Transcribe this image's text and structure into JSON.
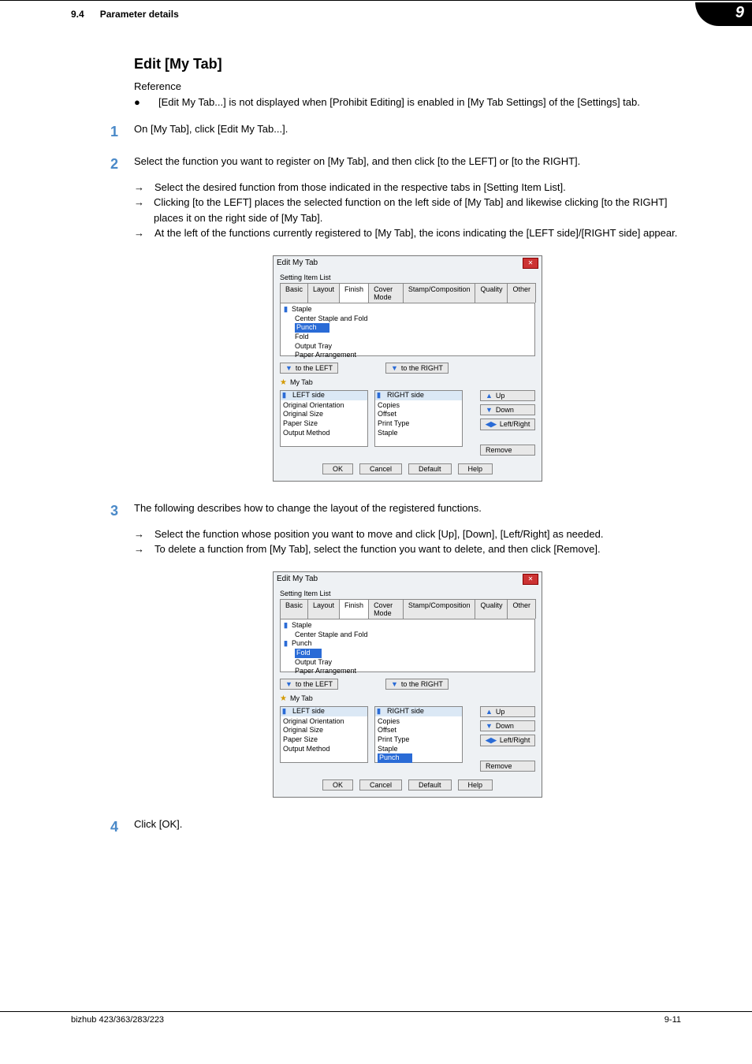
{
  "header": {
    "num": "9.4",
    "title": "Parameter details",
    "badge": "9"
  },
  "heading": "Edit [My Tab]",
  "ref_label": "Reference",
  "bullet1": "[Edit My Tab...] is not displayed when [Prohibit Editing] is enabled in [My Tab Settings] of the [Settings] tab.",
  "step1": "On [My Tab], click [Edit My Tab...].",
  "step2": "Select the function you want to register on [My Tab], and then click [to the LEFT] or [to the RIGHT].",
  "step2a": "Select the desired function from those indicated in the respective tabs in [Setting Item List].",
  "step2b": "Clicking [to the LEFT] places the selected function on the left side of [My Tab] and likewise clicking [to the RIGHT] places it on the right side of [My Tab].",
  "step2c": "At the left of the functions currently registered to [My Tab], the icons indicating the [LEFT side]/[RIGHT side] appear.",
  "step3": "The following describes how to change the layout of the registered functions.",
  "step3a": "Select the function whose position you want to move and click [Up], [Down], [Left/Right] as needed.",
  "step3b": "To delete a function from [My Tab], select the function you want to delete, and then click [Remove].",
  "step4": "Click [OK].",
  "dialog": {
    "title": "Edit My Tab",
    "sil": "Setting Item List",
    "tabs": [
      "Basic",
      "Layout",
      "Finish",
      "Cover Mode",
      "Stamp/Composition",
      "Quality",
      "Other"
    ],
    "to_left": "to the LEFT",
    "to_right": "to the RIGHT",
    "mytab": "My Tab",
    "left_hdr": "LEFT side",
    "right_hdr": "RIGHT side",
    "up": "Up",
    "down": "Down",
    "lr": "Left/Right",
    "remove": "Remove",
    "ok": "OK",
    "cancel": "Cancel",
    "default": "Default",
    "help": "Help",
    "fin_items_1": {
      "staple": "Staple",
      "csf": "Center Staple and Fold",
      "sel": "Punch",
      "fold": "Fold",
      "ot": "Output Tray",
      "pa": "Paper Arrangement"
    },
    "fin_items_2": {
      "staple": "Staple",
      "csf": "Center Staple and Fold",
      "punch": "Punch",
      "sel": "Fold",
      "ot": "Output Tray",
      "pa": "Paper Arrangement"
    },
    "left_items": {
      "a": "Original Orientation",
      "b": "Original Size",
      "c": "Paper Size",
      "d": "Output Method"
    },
    "right_items_1": {
      "a": "Copies",
      "b": "Offset",
      "c": "Print Type",
      "d": "Staple"
    },
    "right_items_2": {
      "a": "Copies",
      "b": "Offset",
      "c": "Print Type",
      "d": "Staple",
      "sel": "Punch"
    }
  },
  "footer": {
    "left": "bizhub 423/363/283/223",
    "right": "9-11"
  }
}
